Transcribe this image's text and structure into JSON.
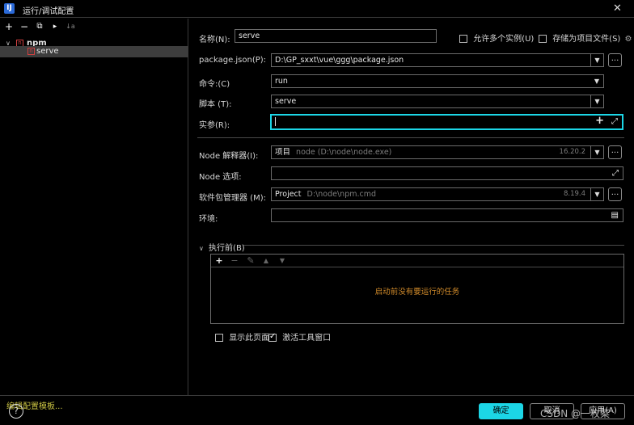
{
  "window": {
    "title": "运行/调试配置",
    "app_icon": "IJ",
    "close": "✕"
  },
  "left_toolbar": {
    "add": "+",
    "remove": "−",
    "copy": "⧉",
    "move": "▸",
    "sort": "↓a"
  },
  "tree": {
    "group": {
      "expand": "∨",
      "label": "npm"
    },
    "item": {
      "label": "serve"
    }
  },
  "left_footer": {
    "edit_templates": "编辑配置模板..."
  },
  "form": {
    "name": {
      "label": "名称(N):",
      "value": "serve"
    },
    "allow_multiple": {
      "label": "允许多个实例(U)",
      "checked": false
    },
    "store_as_project": {
      "label": "存储为项目文件(S)",
      "checked": false
    },
    "package_json": {
      "label": "package.json(P):",
      "value": "D:\\GP_sxxt\\vue\\ggg\\package.json"
    },
    "command": {
      "label": "命令:(C)",
      "value": "run"
    },
    "script": {
      "label": "脚本 (T):",
      "value": "serve"
    },
    "args": {
      "label": "实参(R):",
      "value": "",
      "plus": "+",
      "expand": "⤢"
    },
    "node_interpreter": {
      "label": "Node 解释器(I):",
      "prefix": "项目",
      "value": "node (D:\\node\\node.exe)",
      "version": "16.20.2"
    },
    "node_options": {
      "label": "Node 选项:",
      "value": "",
      "expand": "⤢"
    },
    "package_manager": {
      "label": "软件包管理器 (M):",
      "prefix": "Project",
      "value": "D:\\node\\npm.cmd",
      "version": "8.19.4"
    },
    "env": {
      "label": "环境:",
      "value": "",
      "icon": "▤"
    },
    "dots": "...",
    "arrow": "▼"
  },
  "before_launch": {
    "header": "执行前(B)",
    "chevron": "∨",
    "toolbar": {
      "add": "+",
      "remove": "−",
      "edit": "✎",
      "up": "▲",
      "down": "▼"
    },
    "empty_text": "启动前没有要运行的任务",
    "show_page": {
      "label": "显示此页面",
      "checked": false
    },
    "activate_tool": {
      "label": "激活工具窗口",
      "checked": true
    }
  },
  "bottom": {
    "help": "?",
    "ok": "确定",
    "cancel": "取消",
    "apply": "应用(A)",
    "watermark": "CSDN @一枚菜"
  },
  "colors": {
    "accent": "#1cd6e6",
    "link": "#c9c242",
    "empty_text": "#d08a2a",
    "selection": "#3d3d3d"
  }
}
